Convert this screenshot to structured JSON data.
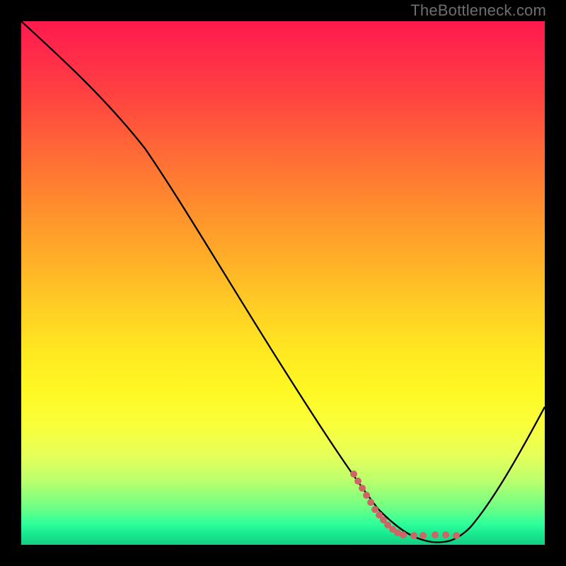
{
  "watermark": "TheBottleneck.com",
  "colors": {
    "curve": "#000000",
    "dots": "#cc6666",
    "background_frame": "#000000"
  },
  "chart_data": {
    "type": "line",
    "title": "",
    "xlabel": "",
    "ylabel": "",
    "xlim": [
      0,
      100
    ],
    "ylim": [
      0,
      100
    ],
    "grid": false,
    "legend": false,
    "series": [
      {
        "name": "bottleneck-curve",
        "x": [
          0,
          7,
          14,
          20,
          27,
          34,
          41,
          48,
          55,
          62,
          68,
          72,
          76,
          80,
          84,
          88,
          92,
          96,
          100
        ],
        "y": [
          100,
          93,
          86,
          78,
          67,
          56,
          45,
          34,
          24,
          14,
          7,
          4,
          2,
          1,
          3,
          8,
          15,
          23,
          32
        ]
      }
    ],
    "highlight_region": {
      "name": "optimal-range-dots",
      "x": [
        62,
        64,
        66,
        68,
        70,
        72,
        74,
        76,
        78,
        80,
        82
      ],
      "y": [
        14,
        11,
        9,
        7,
        5,
        4,
        3,
        2,
        2,
        1,
        2
      ]
    }
  }
}
